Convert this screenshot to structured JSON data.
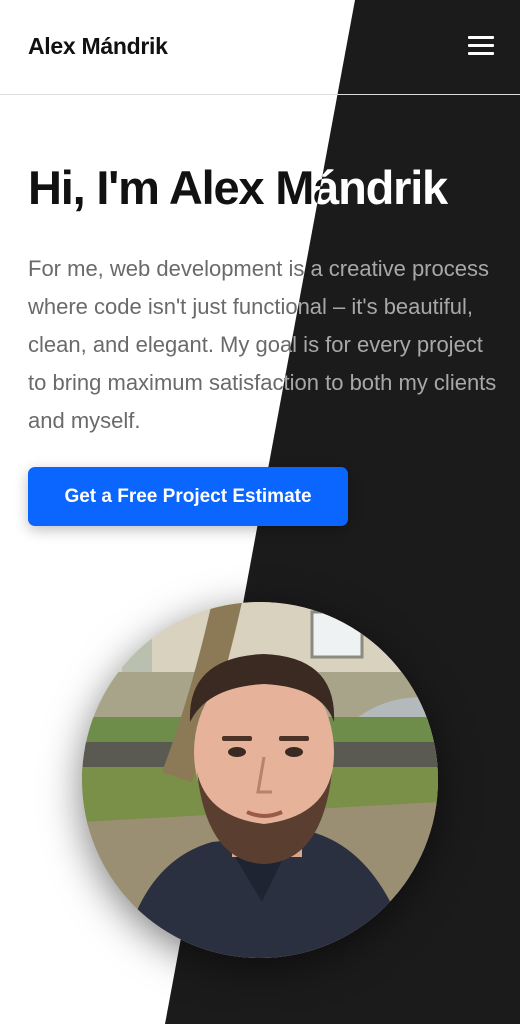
{
  "header": {
    "brand": "Alex Mándrik",
    "menu_icon": "hamburger-menu-icon"
  },
  "hero": {
    "title": "Hi, I'm Alex Mándrik",
    "description": "For me, web development is a creative process where code isn't just functional – it's beautiful, clean, and elegant. My goal is for every project to bring maximum satisfaction to both my clients and myself.",
    "cta_label": "Get a Free Project Estimate"
  },
  "colors": {
    "accent": "#0a66ff",
    "dark_bg": "#1b1b1b",
    "light_bg": "#ffffff"
  },
  "profile_image": {
    "alt": "Alex Mándrik"
  }
}
